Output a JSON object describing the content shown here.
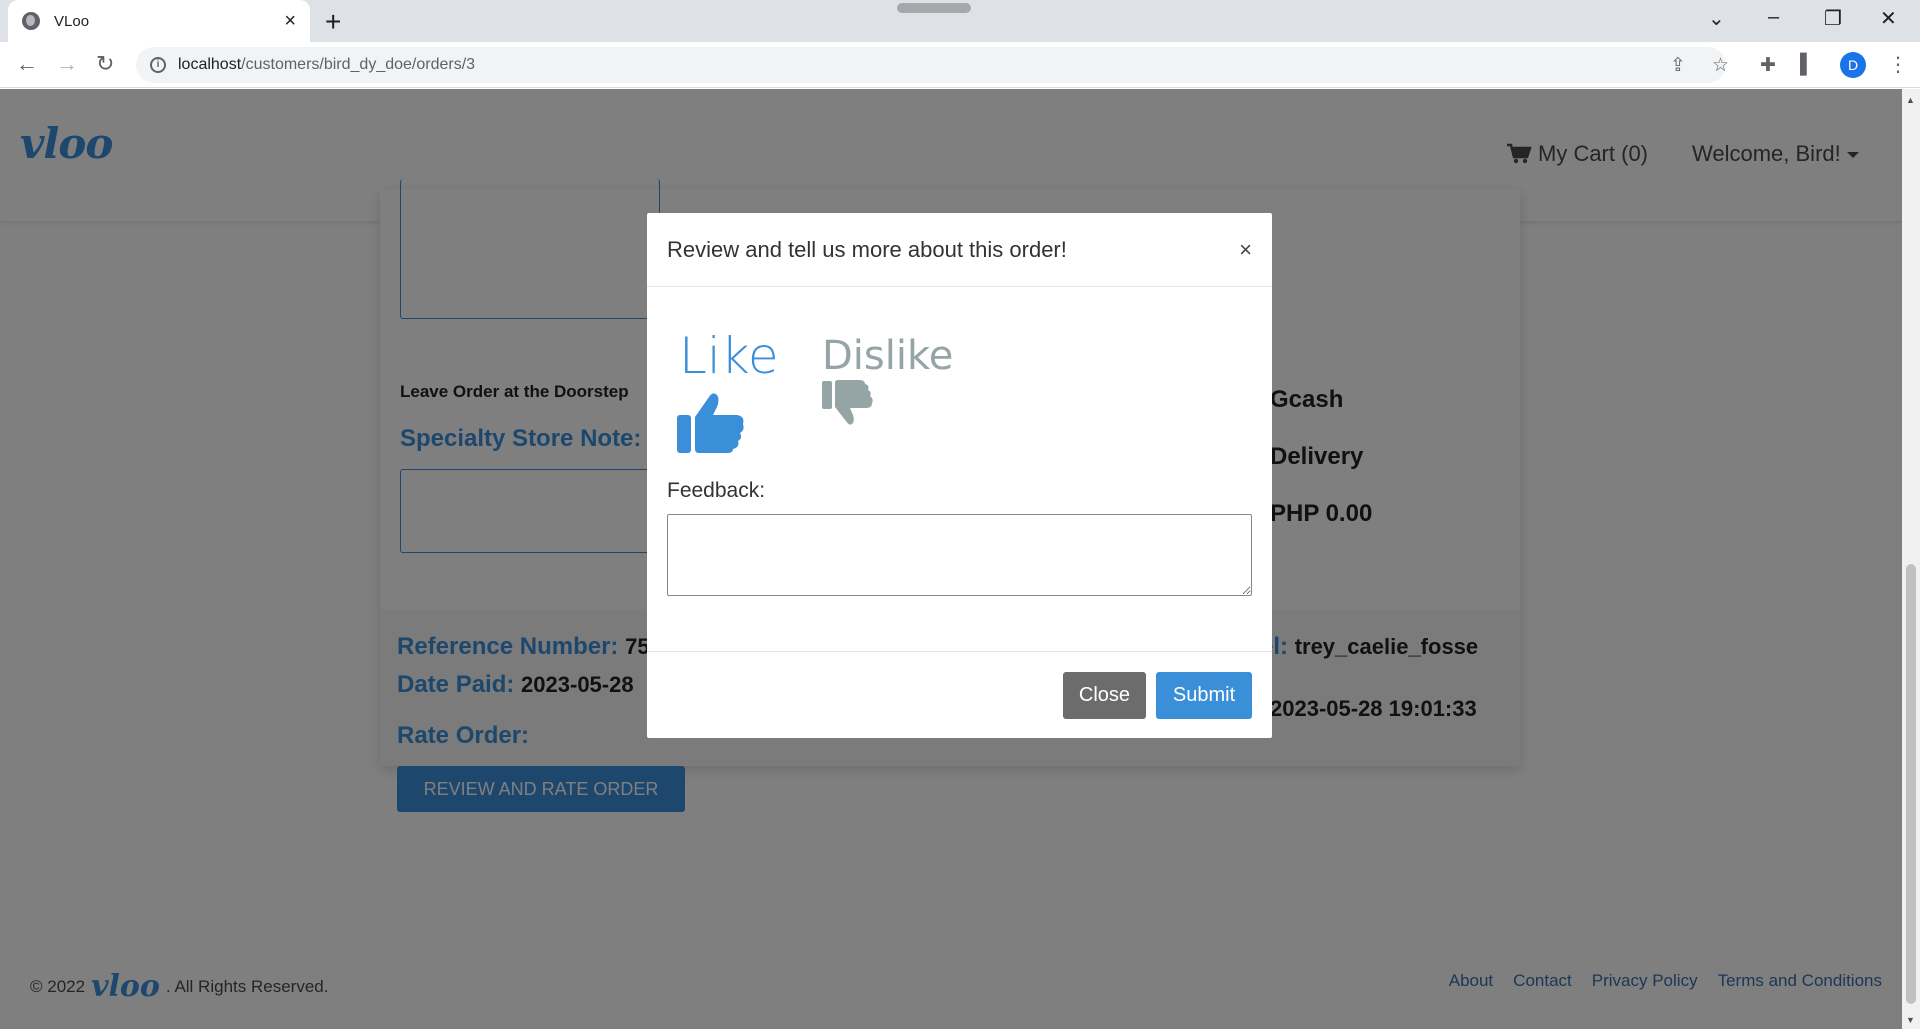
{
  "browser": {
    "tab_title": "VLoo",
    "tab_close": "×",
    "new_tab": "+",
    "url_host": "localhost",
    "url_path": "/customers/bird_dy_doe/orders/3",
    "profile_initial": "D",
    "minimize": "–",
    "restore": "❐",
    "close": "✕",
    "chevron": "⌄"
  },
  "header": {
    "logo": "vloo",
    "cart": "My Cart (0)",
    "welcome": "Welcome, Bird!"
  },
  "order": {
    "doorstep_text": "Leave Order at the Doorstep",
    "specialty_note_label": "Specialty Store Note:",
    "payment_method": "Gcash",
    "delivery": "Delivery",
    "amount": "PHP 0.00",
    "reference_label": "Reference Number:",
    "reference_value": "75",
    "date_paid_label": "Date Paid:",
    "date_paid_value": "2023-05-28",
    "rider_label": "el:",
    "rider_value": "trey_caelie_fosse",
    "date_right_value": "2023-05-28 19:01:33",
    "rate_label": "Rate Order:",
    "rate_button": "REVIEW AND RATE ORDER"
  },
  "footer": {
    "copyright": "© 2022",
    "logo": "vloo",
    "rights": ". All Rights Reserved.",
    "links": [
      "About",
      "Contact",
      "Privacy Policy",
      "Terms and Conditions"
    ]
  },
  "modal": {
    "title": "Review and tell us more about this order!",
    "close_x": "×",
    "like_label": "Like",
    "dislike_label": "Dislike",
    "feedback_label": "Feedback:",
    "feedback_value": "",
    "close_button": "Close",
    "submit_button": "Submit"
  },
  "colors": {
    "accent": "#3b8fd8",
    "muted": "#95a5a6",
    "close_button": "#6c6c6c"
  }
}
